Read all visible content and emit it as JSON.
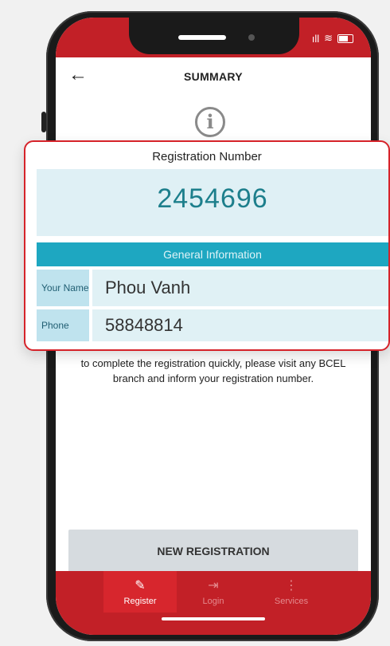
{
  "status_bar": {
    "signal": "ıll",
    "wifi": "≋"
  },
  "header": {
    "title": "SUMMARY",
    "back_icon": "arrow-left-icon"
  },
  "info_icon_glyph": "i",
  "card": {
    "heading": "Registration Number",
    "registration_number": "2454696",
    "section_title": "General Information",
    "rows": [
      {
        "label": "Your Name",
        "value": "Phou Vanh"
      },
      {
        "label": "Phone",
        "value": "58848814"
      }
    ]
  },
  "instruction": "to complete the registration quickly, please visit any BCEL branch and inform your registration number.",
  "new_registration_label": "NEW REGISTRATION",
  "bottom_nav": {
    "items": [
      {
        "label": "Register",
        "icon": "edit-icon",
        "glyph": "✎",
        "active": true
      },
      {
        "label": "Login",
        "icon": "login-icon",
        "glyph": "⇥",
        "active": false
      },
      {
        "label": "Services",
        "icon": "more-vertical-icon",
        "glyph": "⋮",
        "active": false
      }
    ]
  },
  "colors": {
    "brand_red": "#c22027",
    "accent_teal": "#1ea7c1",
    "number_teal": "#1d7f8c",
    "card_border": "#d6232a"
  }
}
